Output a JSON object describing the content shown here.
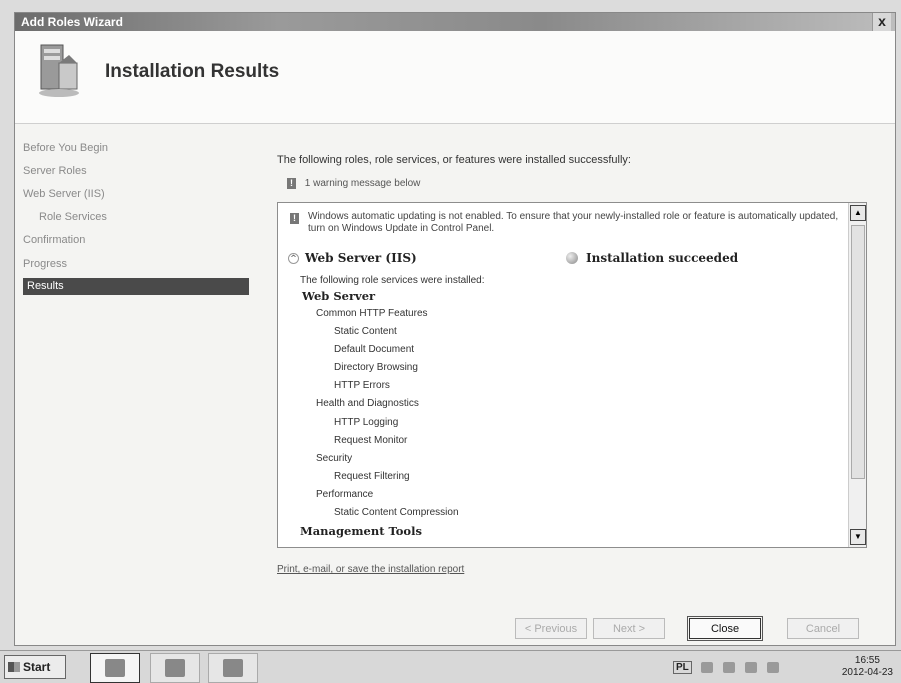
{
  "window": {
    "title": "Add Roles Wizard",
    "close_glyph": "x"
  },
  "header": {
    "title": "Installation Results",
    "icon": "server-roles-icon"
  },
  "sidebar": {
    "items": [
      {
        "label": "Before You Begin",
        "active": false
      },
      {
        "label": "Server Roles",
        "active": false
      },
      {
        "label": "Web Server (IIS)",
        "active": false
      },
      {
        "label": "Role Services",
        "active": false
      },
      {
        "label": "Confirmation",
        "active": false
      },
      {
        "label": "Progress",
        "active": false
      },
      {
        "label": "Results",
        "active": true
      }
    ]
  },
  "main": {
    "intro": "The following roles, role services, or features were installed successfully:",
    "warning_count": "1 warning message below",
    "warning_message": "Windows automatic updating is not enabled. To ensure that your newly-installed role or feature is automatically updated, turn on Windows Update in Control Panel.",
    "section": {
      "title": "Web Server (IIS)",
      "status": "Installation succeeded"
    },
    "tree_intro": "The following role services were installed:",
    "tree": [
      "Web Server",
      "Common HTTP Features",
      "Static Content",
      "Default Document",
      "Directory Browsing",
      "HTTP Errors",
      "Health and Diagnostics",
      "HTTP Logging",
      "Request Monitor",
      "Security",
      "Request Filtering",
      "Performance",
      "Static Content Compression",
      "Management Tools"
    ],
    "report_link": "Print, e-mail, or save the installation report"
  },
  "buttons": {
    "previous": "< Previous",
    "next": "Next >",
    "close": "Close",
    "cancel": "Cancel"
  },
  "taskbar": {
    "start": "Start",
    "language": "PL",
    "time": "16:55",
    "date": "2012-04-23"
  }
}
